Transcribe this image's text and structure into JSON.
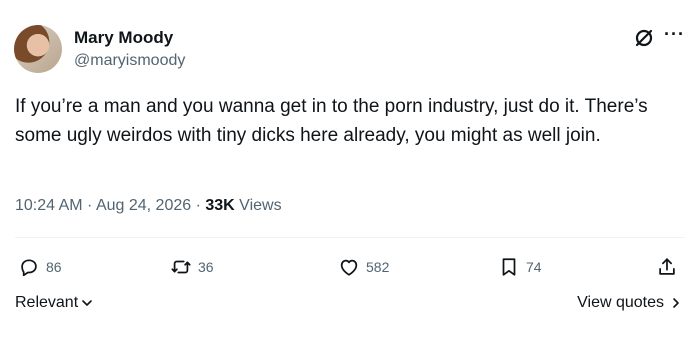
{
  "author": {
    "name": "Mary Moody",
    "handle": "@maryismoody"
  },
  "tweet": {
    "text": "If you’re a man and you wanna get in to the porn industry, just do it. There’s some ugly weirdos with tiny dicks here already, you might as well join.",
    "time": "10:24 AM",
    "separator1": " · ",
    "date": "Aug 24, 2026",
    "separator2": " · ",
    "views_count": "33K",
    "views_label": " Views"
  },
  "actions": {
    "replies": "86",
    "reposts": "36",
    "likes": "582",
    "bookmarks": "74"
  },
  "footer": {
    "sort_label": "Relevant",
    "view_quotes_label": "View quotes"
  },
  "icons": {
    "avatar": "avatar-photo",
    "grok": "grok-icon",
    "more": "more-icon",
    "reply": "reply-icon",
    "repost": "repost-icon",
    "like": "heart-icon",
    "bookmark": "bookmark-icon",
    "share": "share-icon",
    "chevron_down": "chevron-down-icon",
    "chevron_right": "chevron-right-icon"
  }
}
